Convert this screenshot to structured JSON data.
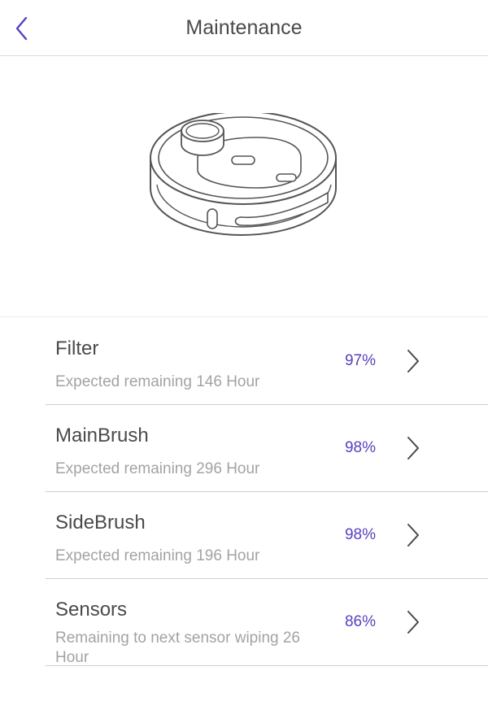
{
  "header": {
    "title": "Maintenance",
    "back_icon": "chevron-left-icon",
    "accent_color": "#5a3fc0"
  },
  "hero": {
    "image": "robot-vacuum-illustration"
  },
  "items": [
    {
      "name": "Filter",
      "detail": "Expected remaining 146 Hour",
      "percent": "97%"
    },
    {
      "name": "MainBrush",
      "detail": "Expected remaining 296 Hour",
      "percent": "98%"
    },
    {
      "name": "SideBrush",
      "detail": "Expected remaining 196 Hour",
      "percent": "98%"
    },
    {
      "name": "Sensors",
      "detail": "Remaining to next sensor wiping 26 Hour",
      "percent": "86%"
    }
  ]
}
